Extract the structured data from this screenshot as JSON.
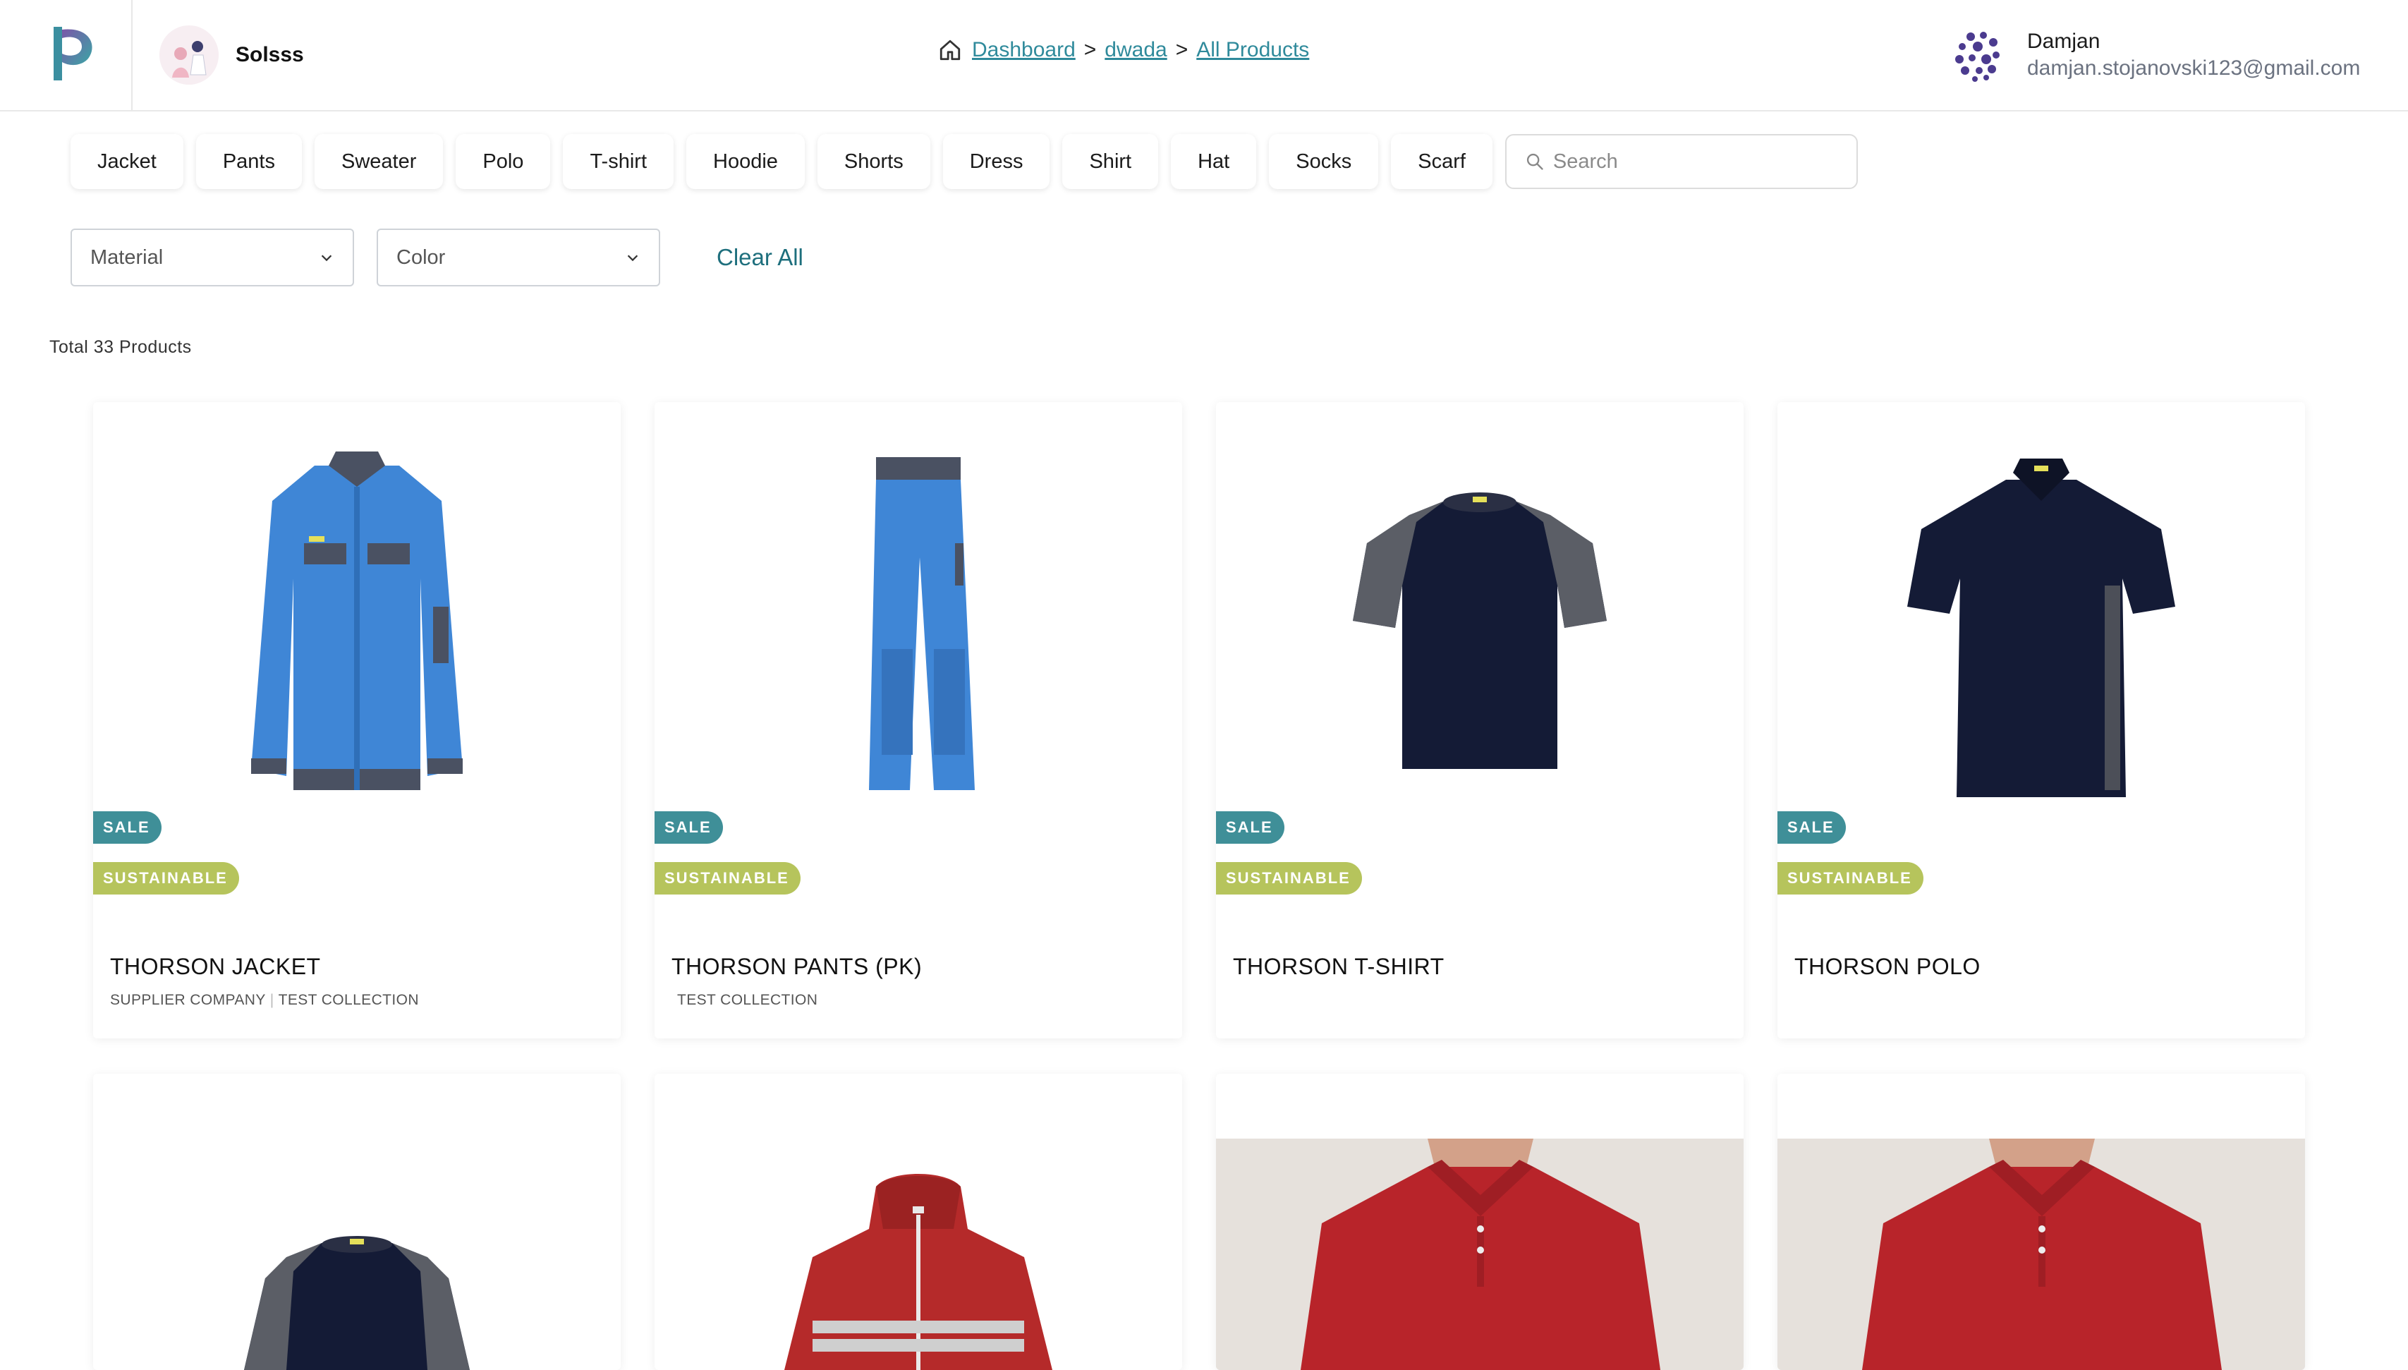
{
  "org": {
    "name": "Solsss"
  },
  "breadcrumb": {
    "items": [
      "Dashboard",
      "dwada",
      "All Products"
    ],
    "separator": ">"
  },
  "user": {
    "name": "Damjan",
    "email": "damjan.stojanovski123@gmail.com"
  },
  "categories": [
    "Jacket",
    "Pants",
    "Sweater",
    "Polo",
    "T-shirt",
    "Hoodie",
    "Shorts",
    "Dress",
    "Shirt",
    "Hat",
    "Socks",
    "Scarf"
  ],
  "search": {
    "placeholder": "Search"
  },
  "filters": {
    "material_label": "Material",
    "color_label": "Color",
    "clear_label": "Clear All"
  },
  "summary": {
    "total_text": "Total 33 Products"
  },
  "badges": {
    "sale": "SALE",
    "sustainable": "SUSTAINABLE"
  },
  "products": [
    {
      "title": "THORSON JACKET",
      "supplier": "SUPPLIER COMPANY",
      "collection": "TEST COLLECTION",
      "image": "blue-work-jacket"
    },
    {
      "title": "THORSON PANTS (PK)",
      "supplier": "",
      "collection": "TEST COLLECTION",
      "image": "blue-work-pants"
    },
    {
      "title": "THORSON T-SHIRT",
      "supplier": "",
      "collection": "",
      "image": "navy-grey-tshirt"
    },
    {
      "title": "THORSON POLO",
      "supplier": "",
      "collection": "",
      "image": "navy-polo"
    },
    {
      "title": "",
      "supplier": "",
      "collection": "",
      "image": "navy-grey-longsleeve"
    },
    {
      "title": "",
      "supplier": "",
      "collection": "",
      "image": "red-reflective-hoodie"
    },
    {
      "title": "",
      "supplier": "",
      "collection": "",
      "image": "red-polo-model"
    },
    {
      "title": "",
      "supplier": "",
      "collection": "",
      "image": "red-polo-model"
    }
  ],
  "colors": {
    "accent": "#2f8a9b",
    "sale_badge": "#3f8f98",
    "sustainable_badge": "#b6c45c"
  }
}
